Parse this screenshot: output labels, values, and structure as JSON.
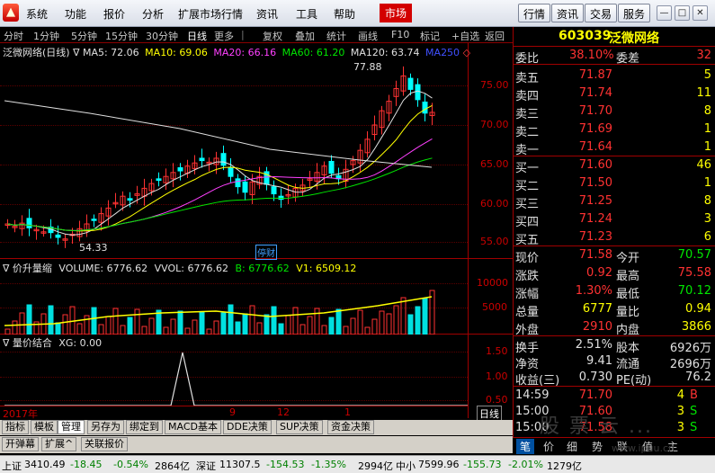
{
  "menubar": {
    "items": [
      "系统",
      "功能",
      "报价",
      "分析",
      "扩展市场行情",
      "资讯",
      "工具",
      "帮助"
    ],
    "active": "市场",
    "right_buttons": [
      "行情",
      "资讯",
      "交易",
      "服务"
    ]
  },
  "toolbar": {
    "periods": [
      "分时",
      "1分钟",
      "5分钟",
      "15分钟",
      "30分钟",
      "日线",
      "更多"
    ],
    "actions": [
      "复权",
      "叠加",
      "统计",
      "画线",
      "F10",
      "标记",
      "+自选",
      "返回"
    ]
  },
  "chart": {
    "title": "泛微网络(日线)",
    "ma_labels": [
      {
        "text": "MA5: 72.06",
        "color": "#e0e0e0"
      },
      {
        "text": "MA10: 69.06",
        "color": "#ffff00"
      },
      {
        "text": "MA20: 66.16",
        "color": "#ff40ff"
      },
      {
        "text": "MA60: 61.20",
        "color": "#00e600"
      },
      {
        "text": "MA120: 63.74",
        "color": "#e0e0e0"
      },
      {
        "text": "MA250",
        "color": "#4050ff"
      }
    ],
    "price_axis": [
      "75.00",
      "70.00",
      "65.00",
      "60.00",
      "55.00"
    ],
    "high_label": "77.88",
    "low_label": "54.33",
    "tag_text": "停财",
    "volume_title": "价升量缩",
    "volume_labels": [
      {
        "text": "VOLUME: 6776.62",
        "color": "#e0e0e0"
      },
      {
        "text": "VVOL: 6776.62",
        "color": "#e0e0e0"
      },
      {
        "text": "B: 6776.62",
        "color": "#00e600"
      },
      {
        "text": "V1: 6509.12",
        "color": "#ffff00"
      }
    ],
    "volume_axis": [
      "10000",
      "5000"
    ],
    "indicator_title": "量价结合",
    "indicator_value": "XG: 0.00",
    "indicator_axis": [
      "1.50",
      "1.00",
      "0.50"
    ],
    "date_labels": [
      "2017年",
      "9",
      "12",
      "1"
    ],
    "period_box": "日线"
  },
  "quote": {
    "code": "603039",
    "name": "泛微网络",
    "weibi": {
      "label": "委比",
      "value": "38.10%",
      "label2": "委差",
      "value2": "32"
    },
    "asks": [
      {
        "label": "卖五",
        "price": "71.87",
        "vol": "5"
      },
      {
        "label": "卖四",
        "price": "71.74",
        "vol": "11"
      },
      {
        "label": "卖三",
        "price": "71.70",
        "vol": "8"
      },
      {
        "label": "卖二",
        "price": "71.69",
        "vol": "1"
      },
      {
        "label": "卖一",
        "price": "71.64",
        "vol": "1"
      }
    ],
    "bids": [
      {
        "label": "买一",
        "price": "71.60",
        "vol": "46"
      },
      {
        "label": "买二",
        "price": "71.50",
        "vol": "1"
      },
      {
        "label": "买三",
        "price": "71.25",
        "vol": "8"
      },
      {
        "label": "买四",
        "price": "71.24",
        "vol": "3"
      },
      {
        "label": "买五",
        "price": "71.23",
        "vol": "6"
      }
    ],
    "stats": [
      {
        "l1": "现价",
        "v1": "71.58",
        "c1": "red",
        "l2": "今开",
        "v2": "70.57",
        "c2": "green"
      },
      {
        "l1": "涨跌",
        "v1": "0.92",
        "c1": "red",
        "l2": "最高",
        "v2": "75.58",
        "c2": "red"
      },
      {
        "l1": "涨幅",
        "v1": "1.30%",
        "c1": "red",
        "l2": "最低",
        "v2": "70.12",
        "c2": "green"
      },
      {
        "l1": "总量",
        "v1": "6777",
        "c1": "yellow",
        "l2": "量比",
        "v2": "0.94",
        "c2": "yellow"
      },
      {
        "l1": "外盘",
        "v1": "2910",
        "c1": "red",
        "l2": "内盘",
        "v2": "3866",
        "c2": "yellow"
      }
    ],
    "stats2": [
      {
        "l1": "换手",
        "v1": "2.51%",
        "l2": "股本",
        "v2": "6926万"
      },
      {
        "l1": "净资",
        "v1": "9.41",
        "l2": "流通",
        "v2": "2696万"
      },
      {
        "l1": "收益(三)",
        "v1": "0.730",
        "l2": "PE(动)",
        "v2": "76.2"
      }
    ],
    "ticks": [
      {
        "time": "14:59",
        "price": "71.70",
        "vol": "4",
        "side": "B",
        "side_color": "red"
      },
      {
        "time": "15:00",
        "price": "71.60",
        "vol": "3",
        "side": "S",
        "side_color": "green"
      },
      {
        "time": "15:00",
        "price": "71.58",
        "vol": "3",
        "side": "S",
        "side_color": "green"
      }
    ],
    "bottom_tabs": [
      "笔",
      "价",
      "细",
      "势",
      "联",
      "值",
      "主"
    ]
  },
  "bottom_tabs": [
    "指标",
    "模板",
    "管理",
    "另存为",
    "绑定到",
    "MACD基本",
    "DDE决策",
    "SUP决策",
    "资金决策"
  ],
  "bottom_tabs2": [
    "开弹幕",
    "扩展^",
    "关联报价"
  ],
  "status": {
    "sh_label": "上证",
    "sh_value": "3410.49",
    "sh_change": "-18.45",
    "sh_pct": "-0.54%",
    "sh_amount": "2864亿",
    "sz_label": "深证",
    "sz_value": "11307.5",
    "sz_change": "-154.53",
    "sz_pct": "-1.35%",
    "sz_amount": "2994亿",
    "zx_label": "中小",
    "zx_value": "7599.96",
    "zx_change": "-155.73",
    "zx_pct": "-2.01%",
    "zx_amount": "1279亿"
  },
  "watermark": "股 票 云 ...",
  "watermark_url": "www.ipuu.cn"
}
